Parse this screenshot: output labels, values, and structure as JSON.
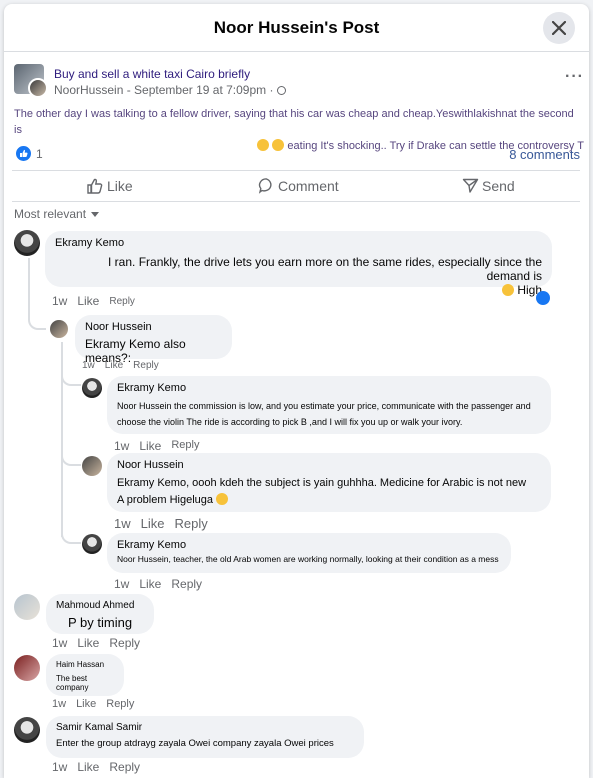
{
  "header": {
    "title": "Noor Hussein's Post"
  },
  "post": {
    "title": "Buy and sell a white taxi Cairo briefly",
    "author": "NoorHussein",
    "date_line": "- September 19 at 7:09pm ·",
    "body_line1": "The other day I was talking to a fellow driver, saying that his car was cheap and cheap.Yeswithlakishnat the second is",
    "body_line2": "eating It's shocking.. Try if Drake can settle the controversy T",
    "reactions": "1",
    "comments_link": "8 comments"
  },
  "actions": {
    "like": "Like",
    "comment": "Comment",
    "send": "Send"
  },
  "sort_label": "Most relevant",
  "comments": [
    {
      "name": "Ekramy Kemo",
      "text1": "I ran. Frankly, the drive lets you earn more on the same rides, especially since the demand is",
      "text2": "High",
      "time": "1w",
      "like": "Like",
      "reply": "Reply"
    },
    {
      "name": "Noor Hussein",
      "text1": "Ekramy Kemo also means?:",
      "time": "1w",
      "like": "Like",
      "reply": "Reply"
    },
    {
      "name": "Ekramy Kemo",
      "text1": "Noor Hussein the commission is low, and you estimate your price, communicate with the passenger and",
      "text2": "choose the violin The ride is according to pick B ,and I will fix you up or walk your ivory.",
      "time": "1w",
      "like": "Like",
      "reply": "Reply"
    },
    {
      "name": "Noor Hussein",
      "text1": "Ekramy Kemo, oooh kdeh the subject is yain guhhha. Medicine for Arabic is not new",
      "text2": "A problem Higeluga",
      "time": "1w",
      "like": "Like",
      "reply": "Reply"
    },
    {
      "name": "Ekramy Kemo",
      "text1": "Noor Hussein, teacher, the old Arab women are working normally, looking at their condition as a mess",
      "time": "1w",
      "like": "Like",
      "reply": "Reply"
    },
    {
      "name": "Mahmoud Ahmed",
      "text1": "P by timing",
      "time": "1w",
      "like": "Like",
      "reply": "Reply"
    },
    {
      "name": "Haim Hassan",
      "text1": "The best company",
      "time": "1w",
      "like": "Like",
      "reply": "Reply"
    },
    {
      "name": "Samir Kamal Samir",
      "text1": "Enter the group atdrayg zayala Owei company zayala Owei prices",
      "time": "1w",
      "like": "Like",
      "reply": "Reply"
    }
  ],
  "colors": {
    "accent": "#1877f2",
    "link": "#385898",
    "bubble": "#f0f2f5"
  }
}
